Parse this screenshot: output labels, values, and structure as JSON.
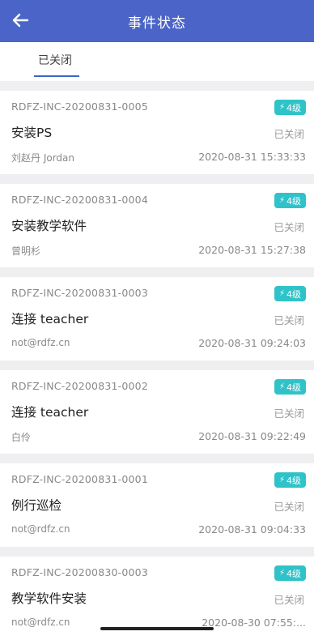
{
  "header": {
    "title": "事件状态",
    "back_icon": "arrow-left-icon"
  },
  "tabs": [
    {
      "label": "已关闭",
      "active": true
    }
  ],
  "colors": {
    "header_bg": "#4b64c7",
    "badge_bg": "#2fc3c9",
    "tab_underline": "#3e64c8"
  },
  "incidents": [
    {
      "id": "RDFZ-INC-20200831-0005",
      "title": "安装PS",
      "status": "已关闭",
      "user": "刘赵丹 Jordan",
      "time": "2020-08-31 15:33:33",
      "level": "4级"
    },
    {
      "id": "RDFZ-INC-20200831-0004",
      "title": "安装教学软件",
      "status": "已关闭",
      "user": "曾明杉",
      "time": "2020-08-31 15:27:38",
      "level": "4级"
    },
    {
      "id": "RDFZ-INC-20200831-0003",
      "title": "连接 teacher",
      "status": "已关闭",
      "user": "not@rdfz.cn",
      "time": "2020-08-31 09:24:03",
      "level": "4级"
    },
    {
      "id": "RDFZ-INC-20200831-0002",
      "title": "连接 teacher",
      "status": "已关闭",
      "user": "白伶",
      "time": "2020-08-31 09:22:49",
      "level": "4级"
    },
    {
      "id": "RDFZ-INC-20200831-0001",
      "title": "例行巡检",
      "status": "已关闭",
      "user": "not@rdfz.cn",
      "time": "2020-08-31 09:04:33",
      "level": "4级"
    },
    {
      "id": "RDFZ-INC-20200830-0003",
      "title": "教学软件安装",
      "status": "已关闭",
      "user": "not@rdfz.cn",
      "time": "2020-08-30 07:55:...",
      "level": "4级"
    }
  ]
}
